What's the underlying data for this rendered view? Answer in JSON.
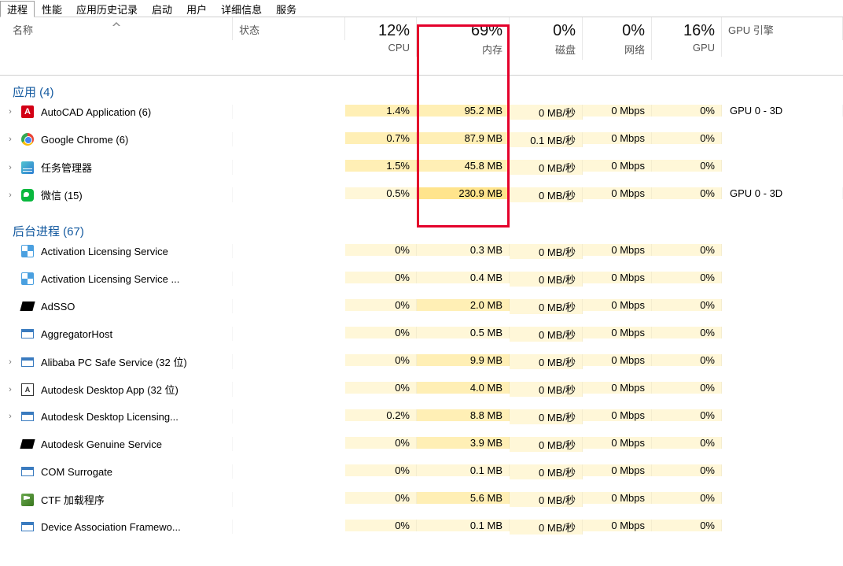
{
  "tabs": [
    "进程",
    "性能",
    "应用历史记录",
    "启动",
    "用户",
    "详细信息",
    "服务"
  ],
  "active_tab": 0,
  "columns": {
    "name": "名称",
    "status": "状态",
    "cpu_pct": "12%",
    "cpu_lbl": "CPU",
    "mem_pct": "69%",
    "mem_lbl": "内存",
    "disk_pct": "0%",
    "disk_lbl": "磁盘",
    "net_pct": "0%",
    "net_lbl": "网络",
    "gpu_pct": "16%",
    "gpu_lbl": "GPU",
    "gpueng_lbl": "GPU 引擎"
  },
  "groups": [
    {
      "title": "应用 (4)",
      "rows": [
        {
          "expand": true,
          "icon": "autocad",
          "name": "AutoCAD Application (6)",
          "cpu": "1.4%",
          "cpu_h": 2,
          "mem": "95.2 MB",
          "mem_h": 2,
          "disk": "0 MB/秒",
          "net": "0 Mbps",
          "gpu": "0%",
          "gpueng": "GPU 0 - 3D"
        },
        {
          "expand": true,
          "icon": "chrome",
          "name": "Google Chrome (6)",
          "cpu": "0.7%",
          "cpu_h": 2,
          "mem": "87.9 MB",
          "mem_h": 2,
          "disk": "0.1 MB/秒",
          "net": "0 Mbps",
          "gpu": "0%",
          "gpueng": ""
        },
        {
          "expand": true,
          "icon": "taskmgr",
          "name": "任务管理器",
          "cpu": "1.5%",
          "cpu_h": 2,
          "mem": "45.8 MB",
          "mem_h": 2,
          "disk": "0 MB/秒",
          "net": "0 Mbps",
          "gpu": "0%",
          "gpueng": ""
        },
        {
          "expand": true,
          "icon": "wechat",
          "name": "微信 (15)",
          "cpu": "0.5%",
          "cpu_h": 1,
          "mem": "230.9 MB",
          "mem_h": 3,
          "disk": "0 MB/秒",
          "net": "0 Mbps",
          "gpu": "0%",
          "gpueng": "GPU 0 - 3D"
        }
      ]
    },
    {
      "title": "后台进程 (67)",
      "rows": [
        {
          "expand": false,
          "icon": "generic-blue",
          "name": "Activation Licensing Service",
          "cpu": "0%",
          "cpu_h": 1,
          "mem": "0.3 MB",
          "mem_h": 1,
          "disk": "0 MB/秒",
          "net": "0 Mbps",
          "gpu": "0%",
          "gpueng": ""
        },
        {
          "expand": false,
          "icon": "generic-blue",
          "name": "Activation Licensing Service ...",
          "cpu": "0%",
          "cpu_h": 1,
          "mem": "0.4 MB",
          "mem_h": 1,
          "disk": "0 MB/秒",
          "net": "0 Mbps",
          "gpu": "0%",
          "gpueng": ""
        },
        {
          "expand": false,
          "icon": "black",
          "name": "AdSSO",
          "cpu": "0%",
          "cpu_h": 1,
          "mem": "2.0 MB",
          "mem_h": 2,
          "disk": "0 MB/秒",
          "net": "0 Mbps",
          "gpu": "0%",
          "gpueng": ""
        },
        {
          "expand": false,
          "icon": "window",
          "name": "AggregatorHost",
          "cpu": "0%",
          "cpu_h": 1,
          "mem": "0.5 MB",
          "mem_h": 1,
          "disk": "0 MB/秒",
          "net": "0 Mbps",
          "gpu": "0%",
          "gpueng": ""
        },
        {
          "expand": true,
          "icon": "window",
          "name": "Alibaba PC Safe Service (32 位)",
          "cpu": "0%",
          "cpu_h": 1,
          "mem": "9.9 MB",
          "mem_h": 2,
          "disk": "0 MB/秒",
          "net": "0 Mbps",
          "gpu": "0%",
          "gpueng": ""
        },
        {
          "expand": true,
          "icon": "ad",
          "name": "Autodesk Desktop App (32 位)",
          "cpu": "0%",
          "cpu_h": 1,
          "mem": "4.0 MB",
          "mem_h": 2,
          "disk": "0 MB/秒",
          "net": "0 Mbps",
          "gpu": "0%",
          "gpueng": ""
        },
        {
          "expand": true,
          "icon": "window",
          "name": "Autodesk Desktop Licensing...",
          "cpu": "0.2%",
          "cpu_h": 1,
          "mem": "8.8 MB",
          "mem_h": 2,
          "disk": "0 MB/秒",
          "net": "0 Mbps",
          "gpu": "0%",
          "gpueng": ""
        },
        {
          "expand": false,
          "icon": "black",
          "name": "Autodesk Genuine Service",
          "cpu": "0%",
          "cpu_h": 1,
          "mem": "3.9 MB",
          "mem_h": 2,
          "disk": "0 MB/秒",
          "net": "0 Mbps",
          "gpu": "0%",
          "gpueng": ""
        },
        {
          "expand": false,
          "icon": "window",
          "name": "COM Surrogate",
          "cpu": "0%",
          "cpu_h": 1,
          "mem": "0.1 MB",
          "mem_h": 1,
          "disk": "0 MB/秒",
          "net": "0 Mbps",
          "gpu": "0%",
          "gpueng": ""
        },
        {
          "expand": false,
          "icon": "ctf",
          "name": "CTF 加载程序",
          "cpu": "0%",
          "cpu_h": 1,
          "mem": "5.6 MB",
          "mem_h": 2,
          "disk": "0 MB/秒",
          "net": "0 Mbps",
          "gpu": "0%",
          "gpueng": ""
        },
        {
          "expand": false,
          "icon": "window",
          "name": "Device Association Framewo...",
          "cpu": "0%",
          "cpu_h": 1,
          "mem": "0.1 MB",
          "mem_h": 1,
          "disk": "0 MB/秒",
          "net": "0 Mbps",
          "gpu": "0%",
          "gpueng": ""
        }
      ]
    }
  ]
}
